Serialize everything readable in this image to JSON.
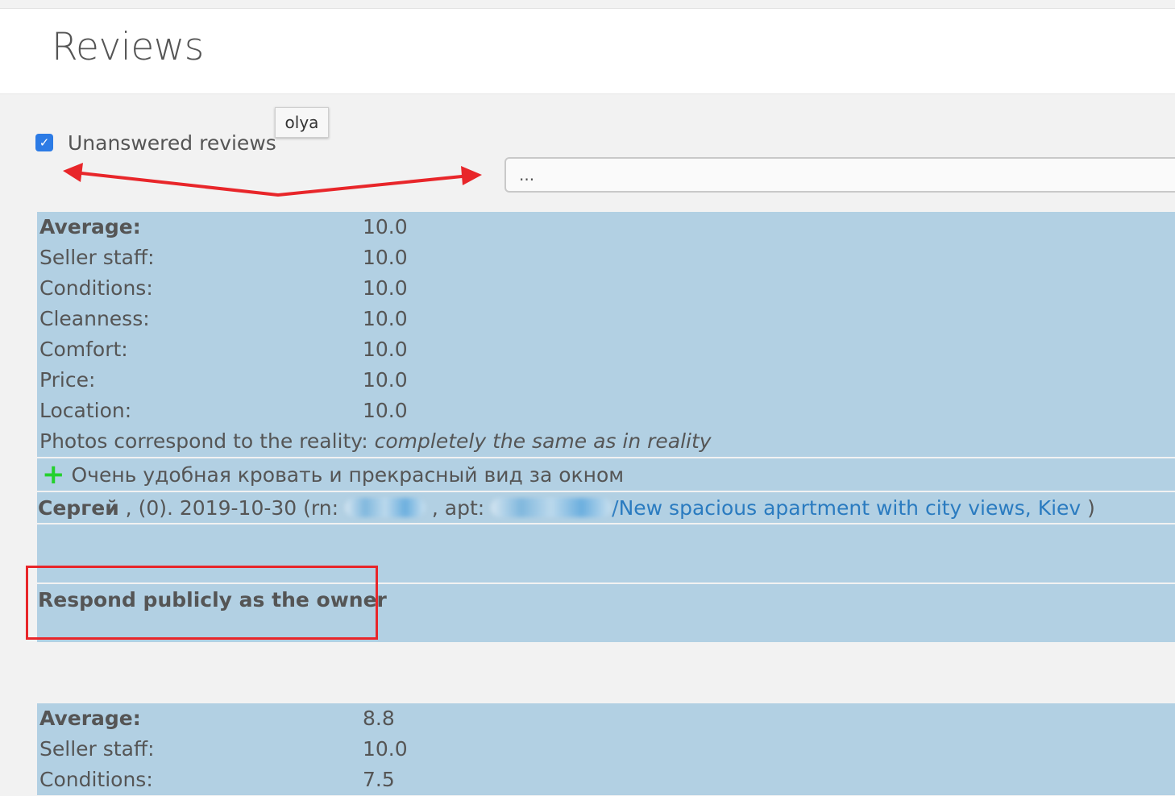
{
  "page": {
    "title": "Reviews"
  },
  "filter": {
    "label": "Unanswered reviews",
    "checked": true
  },
  "tooltip": {
    "text": "olya"
  },
  "search": {
    "value": "..."
  },
  "reviews": [
    {
      "ratings": [
        {
          "label": "Average:",
          "value": "10.0"
        },
        {
          "label": "Seller staff:",
          "value": "10.0"
        },
        {
          "label": "Conditions:",
          "value": "10.0"
        },
        {
          "label": "Cleanness:",
          "value": "10.0"
        },
        {
          "label": "Comfort:",
          "value": "10.0"
        },
        {
          "label": "Price:",
          "value": "10.0"
        },
        {
          "label": "Location:",
          "value": "10.0"
        }
      ],
      "photos_label": "Photos correspond to the reality:",
      "photos_value": "completely the same as in reality",
      "pro_text": "Очень удобная кровать и прекрасный вид за окном",
      "author": "Сергей",
      "meta_count": " , (0). ",
      "date": "2019-10-30",
      "rn_label": " (rn: ",
      "apt_label": " , apt: ",
      "apt_link": "/New spacious apartment with city views, Kiev",
      "close_paren": " )",
      "respond_label": "Respond publicly as the owner"
    },
    {
      "ratings": [
        {
          "label": "Average:",
          "value": "8.8"
        },
        {
          "label": "Seller staff:",
          "value": "10.0"
        },
        {
          "label": "Conditions:",
          "value": "7.5"
        }
      ]
    }
  ],
  "colors": {
    "block_bg": "#b2d0e3",
    "link": "#2a7bc0",
    "checkbox": "#2c7be5",
    "annotation": "#e8262a",
    "plus": "#24d12d"
  },
  "icons": {
    "checkbox": "check-icon",
    "pro": "plus-icon"
  }
}
